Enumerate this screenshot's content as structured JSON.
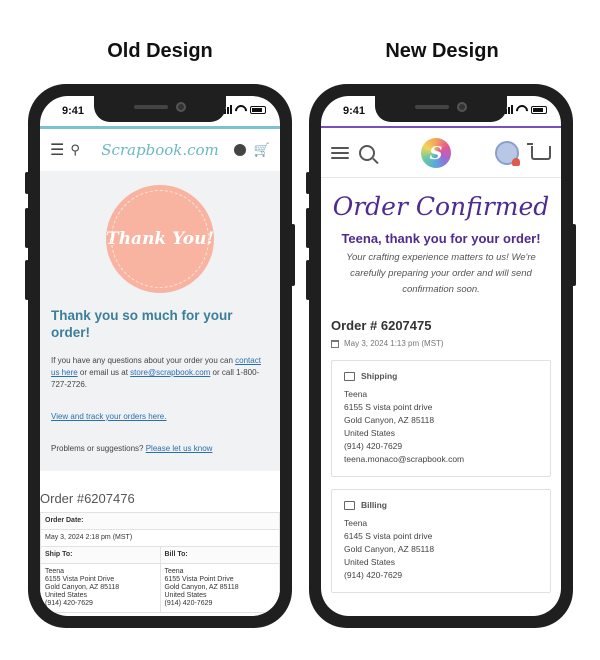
{
  "labels": {
    "old": "Old Design",
    "new": "New Design"
  },
  "status_time": "9:41",
  "old": {
    "logo": "Scrapbook.com",
    "thank_you_badge": "Thank You!",
    "heading": "Thank you so much for your order!",
    "questions_pre": "If you have any questions about your order you can ",
    "contact_link": "contact us here",
    "questions_mid": " or email us at ",
    "email_link": "store@scrapbook.com",
    "questions_post": " or call 1-800-727-2726.",
    "track_link": "View and track your orders here.",
    "problems_text": "Problems or suggestions? ",
    "problems_link": "Please let us know",
    "order_number": "Order #6207476",
    "order_date_label": "Order Date:",
    "order_date": "May 3, 2024 2:18 pm (MST)",
    "ship_to_label": "Ship To:",
    "bill_to_label": "Bill To:",
    "ship_to": {
      "name": "Teena",
      "street": "6155 Vista Point Drive",
      "city": "Gold Canyon, AZ 85118",
      "country": "United States",
      "phone": "(914) 420-7629"
    },
    "bill_to": {
      "name": "Teena",
      "street": "6155 Vista Point Drive",
      "city": "Gold Canyon, AZ 85118",
      "country": "United States",
      "phone": "(914) 420-7629"
    }
  },
  "new": {
    "title": "Order Confirmed",
    "greeting": "Teena, thank you for your order!",
    "message": "Your crafting experience matters to us! We're carefully preparing your order and will send confirmation soon.",
    "order_number": "Order # 6207475",
    "order_date": "May 3, 2024 1:13 pm (MST)",
    "shipping": {
      "label": "Shipping",
      "name": "Teena",
      "street": "6155 S vista point drive",
      "city": "Gold Canyon, AZ 85118",
      "country": "United States",
      "phone": "(914) 420-7629",
      "email": "teena.monaco@scrapbook.com"
    },
    "billing": {
      "label": "Billing",
      "name": "Teena",
      "street": "6145 S vista point drive",
      "city": "Gold Canyon, AZ 85118",
      "country": "United States",
      "phone": "(914) 420-7629"
    }
  }
}
